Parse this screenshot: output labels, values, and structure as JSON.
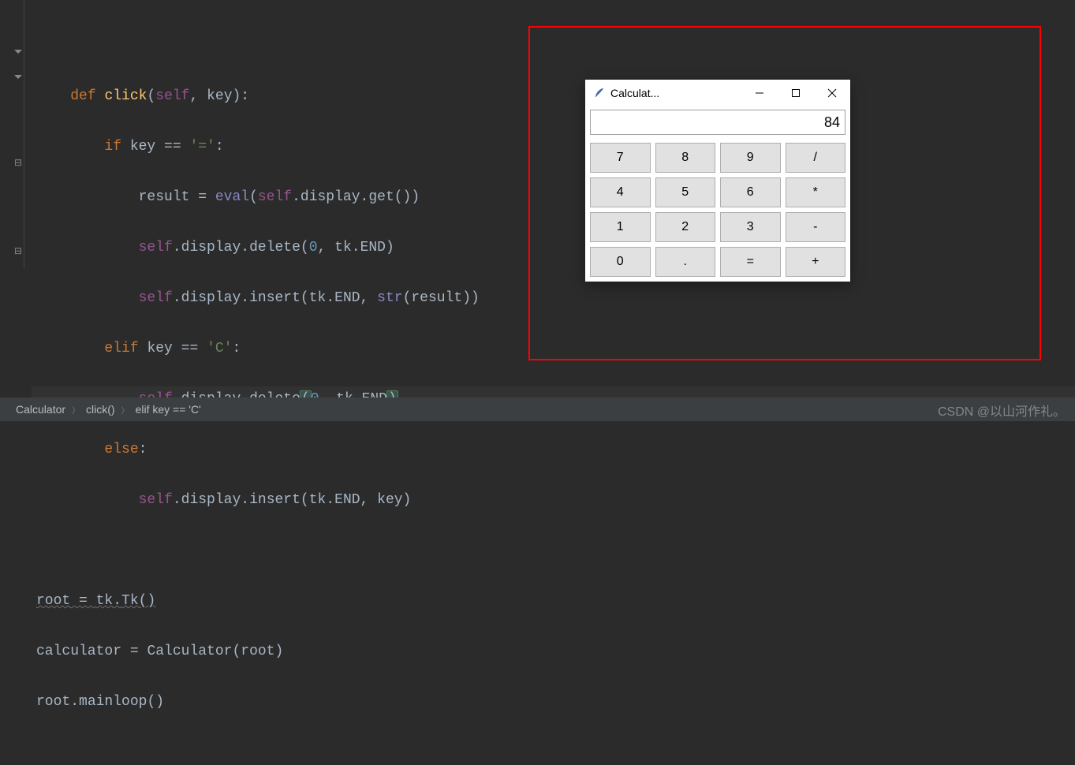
{
  "code": {
    "keywords": {
      "def": "def",
      "if": "if",
      "elif": "elif",
      "else": "else"
    },
    "fn_name": "click",
    "params": {
      "self": "self",
      "key": "key"
    },
    "strings": {
      "eq": "'='",
      "c": "'C'"
    },
    "idents": {
      "result": "result",
      "eval": "eval",
      "display": "display",
      "delete": "delete",
      "get": "get",
      "insert": "insert",
      "tk": "tk",
      "END": "END",
      "str": "str",
      "root": "root",
      "Tk": "Tk",
      "calculator": "calculator",
      "Calculator": "Calculator",
      "mainloop": "mainloop"
    },
    "nums": {
      "zero": "0"
    }
  },
  "calculator": {
    "title": "Calculat...",
    "display_value": "84",
    "buttons": [
      "7",
      "8",
      "9",
      "/",
      "4",
      "5",
      "6",
      "*",
      "1",
      "2",
      "3",
      "-",
      "0",
      ".",
      "=",
      "+"
    ]
  },
  "breadcrumb": {
    "items": [
      "Calculator",
      "click()",
      "elif key == 'C'"
    ]
  },
  "watermark": "CSDN @以山河作礼。"
}
